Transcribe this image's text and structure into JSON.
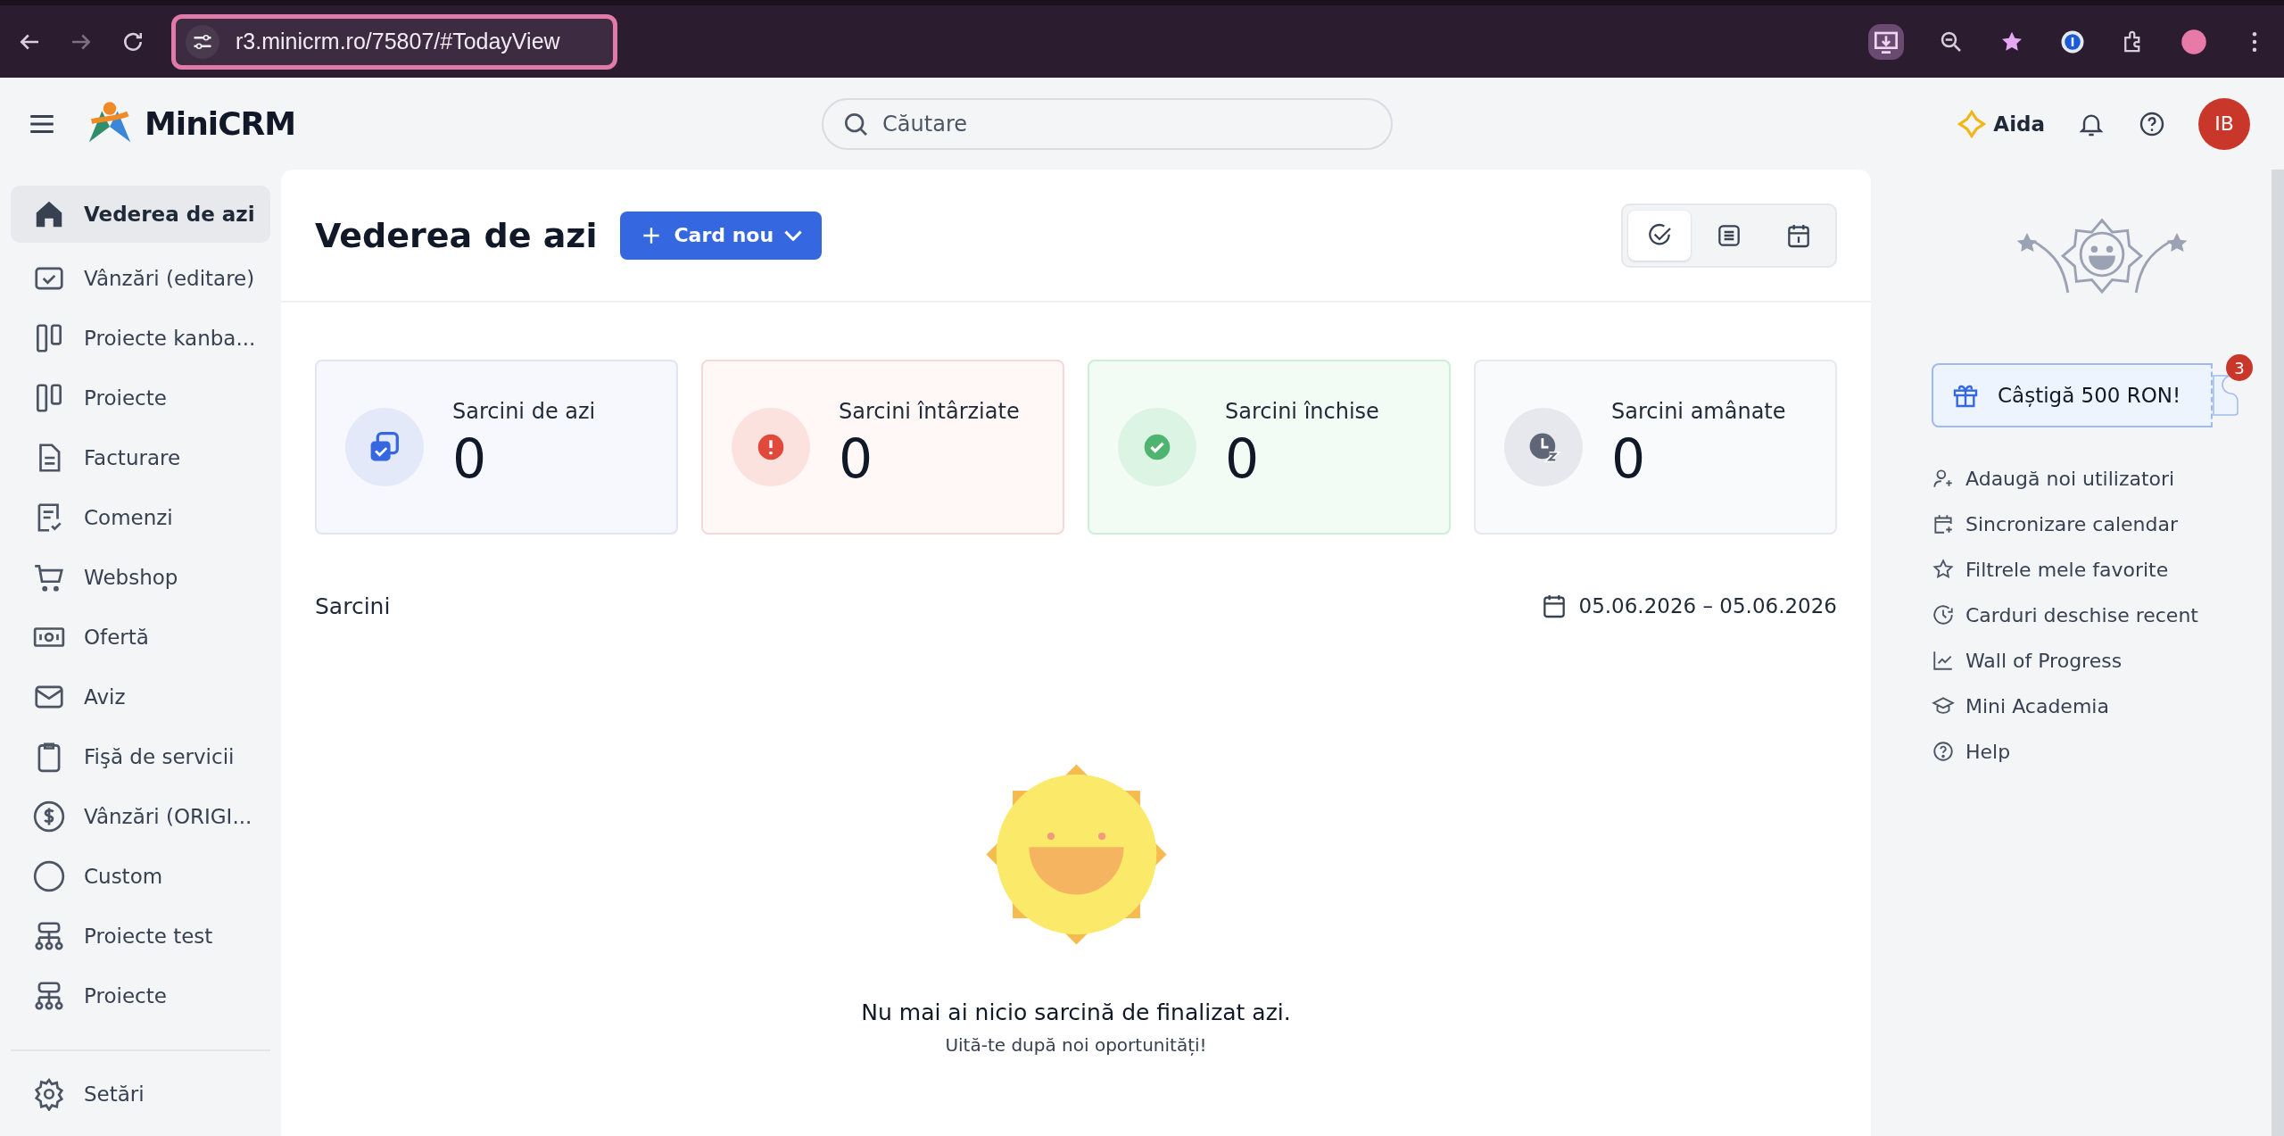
{
  "browser": {
    "url": "r3.minicrm.ro/75807/#TodayView"
  },
  "header": {
    "logo": "MiniCRM",
    "search": {
      "placeholder": "Căutare"
    },
    "assistant": "Aida",
    "avatar": "IB"
  },
  "sidebar": {
    "items": [
      {
        "label": "Vederea de azi",
        "kind": "home",
        "selected": true
      },
      {
        "label": "Vânzări (editare)",
        "kind": "check-square",
        "selected": false
      },
      {
        "label": "Proiecte kanba...",
        "kind": "columns",
        "selected": false
      },
      {
        "label": "Proiecte",
        "kind": "columns",
        "selected": false
      },
      {
        "label": "Facturare",
        "kind": "document",
        "selected": false
      },
      {
        "label": "Comenzi",
        "kind": "checklist",
        "selected": false
      },
      {
        "label": "Webshop",
        "kind": "cart",
        "selected": false
      },
      {
        "label": "Ofertă",
        "kind": "money",
        "selected": false
      },
      {
        "label": "Aviz",
        "kind": "mail",
        "selected": false
      },
      {
        "label": "Fişă de servicii",
        "kind": "clipboard",
        "selected": false
      },
      {
        "label": "Vânzări (ORIGI...",
        "kind": "dollar",
        "selected": false
      },
      {
        "label": "Custom",
        "kind": "circle",
        "selected": false
      },
      {
        "label": "Proiecte test",
        "kind": "hierarchy",
        "selected": false
      },
      {
        "label": "Proiecte",
        "kind": "hierarchy",
        "selected": false
      }
    ],
    "settings": "Setări"
  },
  "main": {
    "title": "Vederea de azi",
    "new_button": "Card nou",
    "views": [
      {
        "kind": "check",
        "selected": true
      },
      {
        "kind": "list",
        "selected": false
      },
      {
        "kind": "calendar",
        "selected": false
      }
    ],
    "stats": [
      {
        "kind": "today",
        "label": "Sarcini de azi",
        "value": "0"
      },
      {
        "kind": "late",
        "label": "Sarcini întârziate",
        "value": "0"
      },
      {
        "kind": "closed",
        "label": "Sarcini închise",
        "value": "0"
      },
      {
        "kind": "postponed",
        "label": "Sarcini amânate",
        "value": "0"
      }
    ],
    "tasks_title": "Sarcini",
    "date_range": "05.06.2026 – 05.06.2026",
    "empty_title": "Nu mai ai nicio sarcină de finalizat azi.",
    "empty_subtitle": "Uită-te după noi oportunități!"
  },
  "right_panel": {
    "promo": "Câștigă 500 RON!",
    "promo_badge": "3",
    "links": [
      {
        "label": "Adaugă noi utilizatori",
        "kind": "user-plus"
      },
      {
        "label": "Sincronizare calendar",
        "kind": "calendar-plus"
      },
      {
        "label": "Filtrele mele favorite",
        "kind": "star"
      },
      {
        "label": "Carduri deschise recent",
        "kind": "clock"
      },
      {
        "label": "Wall of Progress",
        "kind": "chart"
      },
      {
        "label": "Mini Academia",
        "kind": "academy"
      },
      {
        "label": "Help",
        "kind": "help"
      }
    ]
  }
}
